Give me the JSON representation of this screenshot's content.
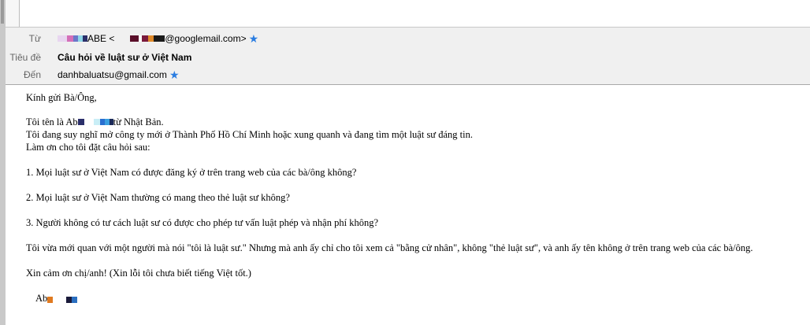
{
  "header": {
    "from_label": "Từ",
    "from_name_suffix": "ABE <",
    "from_email_suffix": "@googlemail.com>",
    "subject_label": "Tiêu đề",
    "subject": "Câu hỏi về luật sư ở Việt Nam",
    "to_label": "Đến",
    "to_email": "danhbaluatsu@gmail.com",
    "star_icon": "star-icon",
    "star_color": "#2a7de1"
  },
  "body": {
    "greeting": "Kính gửi Bà/Ông,",
    "intro_prefix": "Tôi tên là Ab",
    "intro_suffix": "từ Nhật Bản.",
    "line2": "Tôi đang suy nghĩ mở công ty mới ở Thành Phố Hồ Chí Minh hoặc xung quanh và đang tìm một luật sư đáng tin.",
    "line3": "Làm ơn cho tôi đặt câu hỏi sau:",
    "q1": "1. Mọi luật sư ở Việt Nam có được đăng ký ở trên trang web của các bà/ông không?",
    "q2": "2. Mọi luật sư ở Việt Nam thường có mang theo thẻ luật sư không?",
    "q3": "3. Người không có tư cách luật sư có được cho phép tư vấn luật phép và nhận phí không?",
    "story": "Tôi vừa mới quan với một người mà nói \"tôi là luật sư.\"  Nhưng mà anh ấy chỉ cho tôi xem cả \"bằng cử nhân\", không \"thẻ luật sư\", và anh ấy tên không ở trên trang web của các bà/ông.",
    "thanks": "Xin cảm ơn chị/anh! (Xin lỗi tôi chưa biết tiếng Việt tốt.)",
    "signature": "Ab"
  }
}
